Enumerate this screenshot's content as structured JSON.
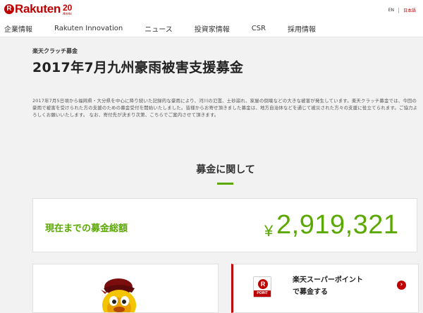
{
  "header": {
    "logo_mark": "R",
    "logo_text": "Rakuten",
    "anniversary_number": "20",
    "anniversary_label": "Anniv.",
    "languages": [
      "EN",
      "日本語"
    ]
  },
  "nav": {
    "items": [
      "企業情報",
      "Rakuten Innovation",
      "ニュース",
      "投資家情報",
      "CSR",
      "採用情報"
    ]
  },
  "article": {
    "kicker": "楽天クラッチ募金",
    "title": "2017年7月九州豪雨被害支援募金",
    "body": "2017年7月5日頃から福岡県・大分県を中心に降り続いた記録的な豪雨により、河川の氾濫、土砂崩れ、家屋の倒壊などの大きな被害が発生しています。楽天クラッチ募金では、今回の豪雨で被害を受けられた方の支援のための募金受付を開始いたしました。皆様からお寄せ頂きました募金は、地方自治体などを通じて被災された方々の支援に役立てられます。ご協力よろしくお願いいたします。 なお、寄付先が決まり次第、こちらでご案内させて頂きます。"
  },
  "donation": {
    "section_title": "募金に関して",
    "total_label": "現在までの募金総額",
    "currency_symbol": "¥",
    "total_value": "2,919,321"
  },
  "point_card": {
    "icon_letter": "R",
    "icon_tag": "POINT",
    "line1": "楽天スーパーポイント",
    "line2": "で募金する",
    "arrow_icon": "chevron-right-icon"
  },
  "colors": {
    "brand_red": "#bf0000",
    "accent_green": "#5aa800"
  }
}
